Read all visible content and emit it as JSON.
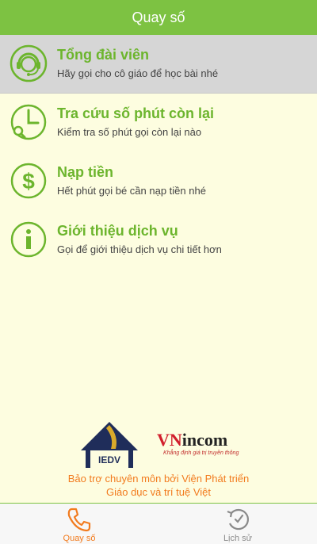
{
  "header": {
    "title": "Quay số"
  },
  "menu": {
    "items": [
      {
        "title": "Tổng đài viên",
        "subtitle": "Hãy gọi cho cô giáo để học bài nhé",
        "icon": "headset-operator-icon"
      },
      {
        "title": "Tra cứu số phút còn lại",
        "subtitle": "Kiểm tra số phút gọi còn lại nào",
        "icon": "clock-search-icon"
      },
      {
        "title": "Nạp tiền",
        "subtitle": "Hết phút gọi bé cần nạp tiền nhé",
        "icon": "dollar-icon"
      },
      {
        "title": "Giới thiệu dịch vụ",
        "subtitle": "Gọi để giới thiệu dịch vụ chi tiết hơn",
        "icon": "info-icon"
      }
    ]
  },
  "sponsor": {
    "iedv_logo_text": "IEDV",
    "vnincom_logo_text": "VNincom",
    "vnincom_tagline": "Khẳng định giá trị truyền thông",
    "line1": "Bảo trợ chuyên môn bởi Viện Phát triển",
    "line2": "Giáo dục và trí tuệ Việt"
  },
  "tabs": [
    {
      "label": "Quay số",
      "icon": "phone-icon",
      "active": true
    },
    {
      "label": "Lịch sử",
      "icon": "history-clock-icon",
      "active": false
    }
  ],
  "colors": {
    "accent": "#7dc242",
    "title_green": "#6cb52d",
    "orange": "#f27b1e",
    "background": "#fdfde0"
  }
}
